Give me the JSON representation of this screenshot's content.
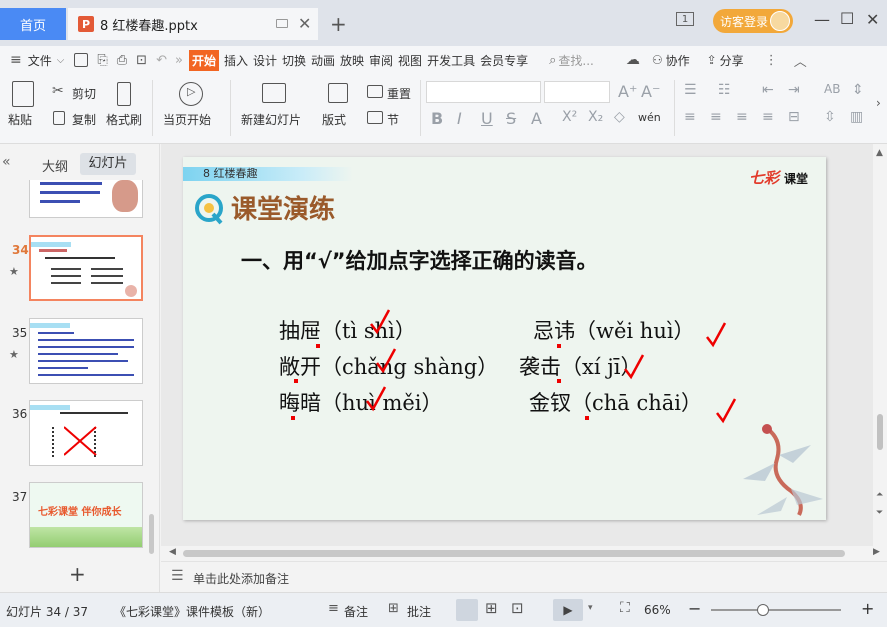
{
  "titlebar": {
    "home_tab": "首页",
    "doc_tab_icon": "P",
    "doc_name": "8 红楼春趣.pptx",
    "new_tab": "+",
    "page_icon": "1",
    "guest_login": "访客登录"
  },
  "menu": {
    "file": "文件",
    "items": [
      "开始",
      "插入",
      "设计",
      "切换",
      "动画",
      "放映",
      "审阅",
      "视图",
      "开发工具",
      "会员专享"
    ],
    "search": "查找...",
    "collab": "协作",
    "share": "分享"
  },
  "ribbon": {
    "paste": "粘贴",
    "cut": "剪切",
    "copy": "复制",
    "format_painter": "格式刷",
    "from_current": "当页开始",
    "new_slide": "新建幻灯片",
    "layout": "版式",
    "reset": "重置",
    "section": "节",
    "phonetic": "wén"
  },
  "left_panel": {
    "tab_outline": "大纲",
    "tab_slides": "幻灯片",
    "thumbs": [
      {
        "num": "34"
      },
      {
        "num": "35"
      },
      {
        "num": "36"
      },
      {
        "num": "37",
        "text": "七彩课堂  伴你成长"
      }
    ],
    "add_button": "+"
  },
  "slide": {
    "band_text": "8    红楼春趣",
    "logo_main": "七彩",
    "logo_sub": "课堂",
    "title": "课堂演练",
    "question": "一、用“√”给加点字选择正确的读音。",
    "rows": [
      {
        "left": "抽屉（tì  shì）",
        "right": "忌讳（wěi   huì）"
      },
      {
        "left": "敞开（chǎng  shàng）",
        "right": "袭击（xí   jī）"
      },
      {
        "left": "晦暗（huì  měi）",
        "right": "金钗（chā   chāi）"
      }
    ]
  },
  "notes": {
    "placeholder": "单击此处添加备注"
  },
  "status": {
    "slide_pos": "幻灯片 34 / 37",
    "template": "《七彩课堂》课件模板（新）",
    "notes_btn": "备注",
    "comment_btn": "批注",
    "zoom": "66%",
    "zoom_level": 0.66
  },
  "colors": {
    "accent": "#4a8af4",
    "start_tab": "#f26522",
    "guest": "#f2a83a",
    "check": "#e00000"
  }
}
